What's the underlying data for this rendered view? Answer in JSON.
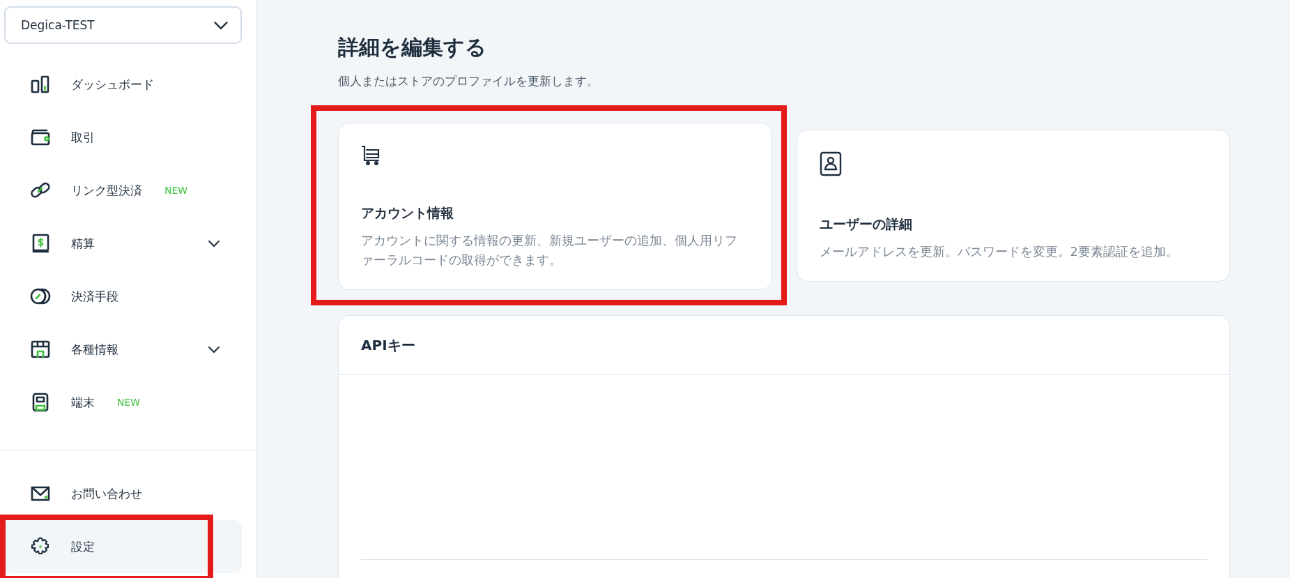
{
  "account_selector": {
    "value": "Degica-TEST"
  },
  "sidebar": {
    "items": [
      {
        "label": "ダッシュボード",
        "selected": false,
        "expandable": false,
        "highlighted": false
      },
      {
        "label": "取引",
        "selected": false,
        "expandable": false,
        "highlighted": false
      },
      {
        "label": "リンク型決済",
        "badge": "NEW",
        "selected": false,
        "expandable": false,
        "highlighted": false
      },
      {
        "label": "精算",
        "selected": false,
        "expandable": true,
        "highlighted": false
      },
      {
        "label": "決済手段",
        "selected": false,
        "expandable": false,
        "highlighted": false
      },
      {
        "label": "各種情報",
        "selected": false,
        "expandable": true,
        "highlighted": false
      },
      {
        "label": "端末",
        "badge": "NEW",
        "selected": false,
        "expandable": false,
        "highlighted": false
      }
    ],
    "footer_items": [
      {
        "label": "お問い合わせ",
        "selected": false,
        "highlighted": false
      },
      {
        "label": "設定",
        "selected": true,
        "highlighted": true
      }
    ]
  },
  "page": {
    "title": "詳細を編集する",
    "subtitle": "個人またはストアのプロファイルを更新します。"
  },
  "cards": [
    {
      "title": "アカウント情報",
      "description": "アカウントに関する情報の更新、新規ユーザーの追加、個人用リファーラルコードの取得ができます。",
      "highlighted": true
    },
    {
      "title": "ユーザーの詳細",
      "description": "メールアドレスを更新。パスワードを変更。2要素認証を追加。",
      "highlighted": false
    }
  ],
  "api_panel": {
    "title": "APIキー"
  }
}
